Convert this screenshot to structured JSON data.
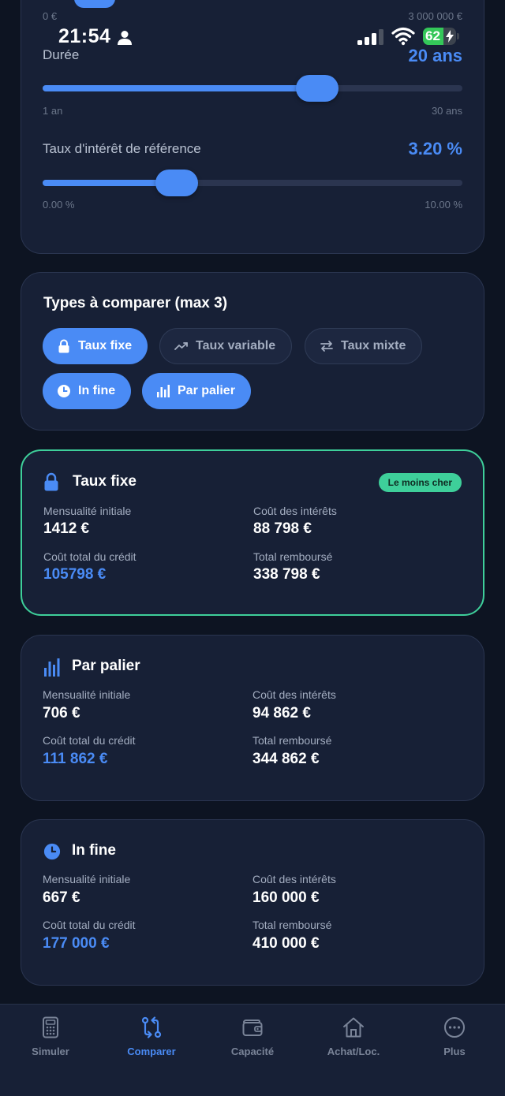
{
  "status_bar": {
    "time": "21:54",
    "battery": "62",
    "battery_level": 0.62
  },
  "top_slider": {
    "min": "0 €",
    "max": "3 000 000 €"
  },
  "duration": {
    "label": "Durée",
    "value": "20 ans",
    "min": "1 an",
    "max": "30 ans",
    "fraction": 0.655
  },
  "rate": {
    "label": "Taux d'intérêt de référence",
    "value": "3.20 %",
    "min": "0.00 %",
    "max": "10.00 %",
    "fraction": 0.32
  },
  "types": {
    "title": "Types à comparer (max 3)",
    "chips": [
      {
        "label": "Taux fixe",
        "icon": "lock-icon",
        "active": true
      },
      {
        "label": "Taux variable",
        "icon": "trend-up-icon",
        "active": false
      },
      {
        "label": "Taux mixte",
        "icon": "swap-arrows-icon",
        "active": false
      },
      {
        "label": "In fine",
        "icon": "clock-icon",
        "active": true
      },
      {
        "label": "Par palier",
        "icon": "bar-chart-icon",
        "active": true
      }
    ]
  },
  "results": [
    {
      "title": "Taux fixe",
      "icon": "lock-icon",
      "badge": "Le moins cher",
      "monthly_label": "Mensualité initiale",
      "monthly": "1412 €",
      "interest_label": "Coût des intérêts",
      "interest": "88 798 €",
      "total_cost_label": "Coût total du crédit",
      "total_cost": "105798 €",
      "repaid_label": "Total remboursé",
      "repaid": "338 798 €"
    },
    {
      "title": "Par palier",
      "icon": "bar-chart-icon",
      "monthly_label": "Mensualité initiale",
      "monthly": "706 €",
      "interest_label": "Coût des intérêts",
      "interest": "94 862 €",
      "total_cost_label": "Coût total du crédit",
      "total_cost": "111 862 €",
      "repaid_label": "Total remboursé",
      "repaid": "344 862 €"
    },
    {
      "title": "In fine",
      "icon": "clock-icon",
      "monthly_label": "Mensualité initiale",
      "monthly": "667 €",
      "interest_label": "Coût des intérêts",
      "interest": "160 000 €",
      "total_cost_label": "Coût total du crédit",
      "total_cost": "177 000 €",
      "repaid_label": "Total remboursé",
      "repaid": "410 000 €"
    }
  ],
  "nav": [
    {
      "label": "Simuler",
      "icon": "calculator-icon",
      "active": false
    },
    {
      "label": "Comparer",
      "icon": "compare-arrows-icon",
      "active": true
    },
    {
      "label": "Capacité",
      "icon": "wallet-icon",
      "active": false
    },
    {
      "label": "Achat/Loc.",
      "icon": "house-icon",
      "active": false
    },
    {
      "label": "Plus",
      "icon": "more-icon",
      "active": false
    }
  ],
  "colors": {
    "accent": "#4a8bf5",
    "success": "#3ecf9a",
    "card": "#172036",
    "background": "#0d1422"
  }
}
